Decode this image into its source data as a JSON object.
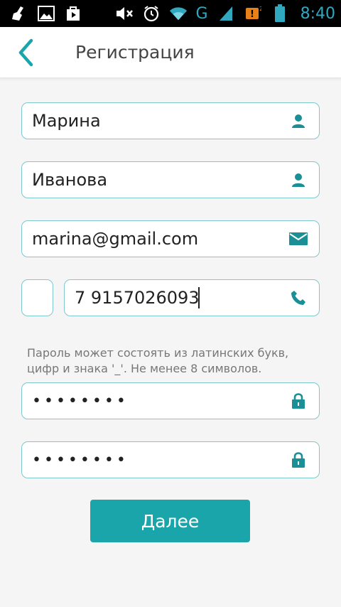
{
  "status_bar": {
    "time": "8:40",
    "network": "G",
    "icons": [
      "broom-icon",
      "image-icon",
      "play-store-icon",
      "mute-icon",
      "alarm-icon",
      "wifi-icon",
      "signal-icon",
      "notification-icon",
      "battery-icon"
    ]
  },
  "app_bar": {
    "title": "Регистрация",
    "back_icon": "chevron-left-icon"
  },
  "form": {
    "first_name": {
      "value": "Марина",
      "icon": "user-icon"
    },
    "last_name": {
      "value": "Иванова",
      "icon": "user-icon"
    },
    "email": {
      "value": "marina@gmail.com",
      "icon": "envelope-icon"
    },
    "country_code": {
      "value": ""
    },
    "phone": {
      "value": "7 9157026093",
      "icon": "phone-icon"
    },
    "password_hint": "Пароль может состоять из латинских букв, цифр и знака '_'. Не менее 8 символов.",
    "password": {
      "value": "••••••••",
      "icon": "lock-icon"
    },
    "password_confirm": {
      "value": "••••••••",
      "icon": "lock-icon"
    },
    "next_label": "Далее"
  },
  "colors": {
    "accent": "#1aa5ab",
    "field_border": "#7fc8cc",
    "icon": "#1a8f95",
    "status_time": "#2fa8c0"
  }
}
